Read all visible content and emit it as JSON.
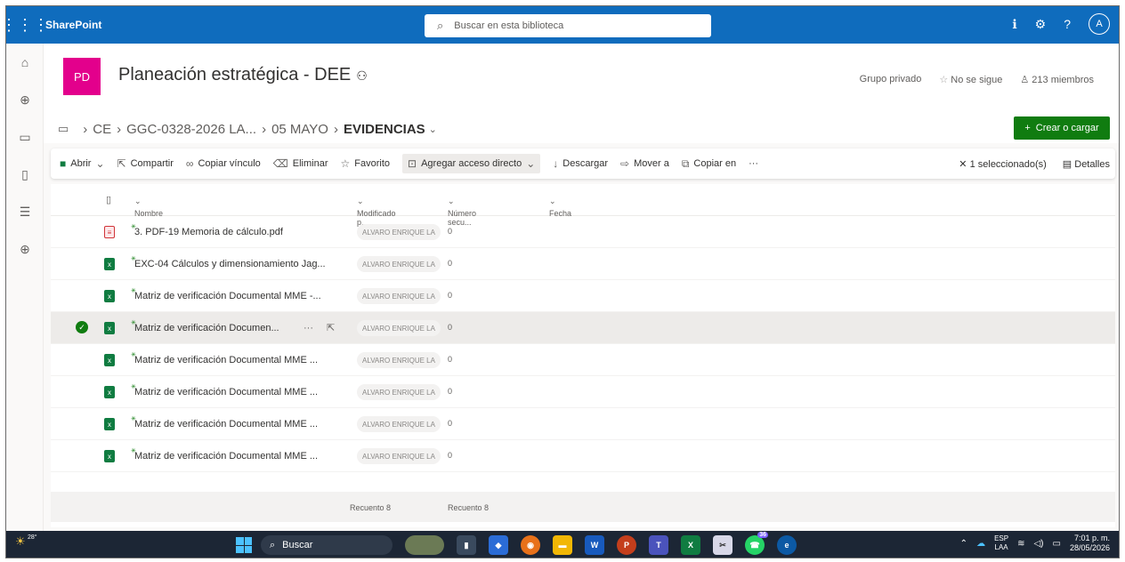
{
  "suite": {
    "brand": "SharePoint",
    "search_placeholder": "Buscar en esta biblioteca",
    "avatar_initial": "A"
  },
  "site": {
    "logo": "PD",
    "title": "Planeación estratégica - DEE",
    "privacy": "Grupo privado",
    "follow": "No se sigue",
    "members": "213 miembros"
  },
  "breadcrumb": {
    "items": [
      "CE",
      "GGC-0328-2026 LA...",
      "05 MAYO"
    ],
    "current": "EVIDENCIAS"
  },
  "new_button": "Crear o cargar",
  "commands": {
    "open": "Abrir",
    "share": "Compartir",
    "copy_link": "Copiar vínculo",
    "delete": "Eliminar",
    "favorite": "Favorito",
    "shortcut": "Agregar acceso directo",
    "download": "Descargar",
    "move": "Mover a",
    "copy": "Copiar en",
    "more": "···",
    "selected": "1 seleccionado(s)",
    "details": "Detalles"
  },
  "columns": {
    "name": "Nombre",
    "modified_by": "Modificado p...",
    "number": "Número secu...",
    "date": "Fecha"
  },
  "files": [
    {
      "type": "pdf",
      "name": "3. PDF-19 Memoria de cálculo.pdf",
      "modified_by": "ALVARO ENRIQUE LA",
      "number": "0"
    },
    {
      "type": "xls",
      "name": "EXC-04 Cálculos y dimensionamiento Jag...",
      "modified_by": "ALVARO ENRIQUE LA",
      "number": "0"
    },
    {
      "type": "xls",
      "name": "Matriz de verificación Documental MME -...",
      "modified_by": "ALVARO ENRIQUE LA",
      "number": "0"
    },
    {
      "type": "xls",
      "name": "Matriz de verificación Documen...",
      "modified_by": "ALVARO ENRIQUE LA",
      "number": "0",
      "selected": true
    },
    {
      "type": "xls",
      "name": "Matriz de verificación Documental MME ...",
      "modified_by": "ALVARO ENRIQUE LA",
      "number": "0"
    },
    {
      "type": "xls",
      "name": "Matriz de verificación Documental MME ...",
      "modified_by": "ALVARO ENRIQUE LA",
      "number": "0"
    },
    {
      "type": "xls",
      "name": "Matriz de verificación Documental MME ...",
      "modified_by": "ALVARO ENRIQUE LA",
      "number": "0"
    },
    {
      "type": "xls",
      "name": "Matriz de verificación Documental MME ...",
      "modified_by": "ALVARO ENRIQUE LA",
      "number": "0"
    }
  ],
  "footer": {
    "count_modified": "Recuento 8",
    "count_number": "Recuento 8"
  },
  "taskbar": {
    "temperature": "28°",
    "search": "Buscar",
    "lang_top": "ESP",
    "lang_bottom": "LAA",
    "time": "7:01 p. m.",
    "date": "28/05/2026",
    "whatsapp_badge": "36"
  }
}
